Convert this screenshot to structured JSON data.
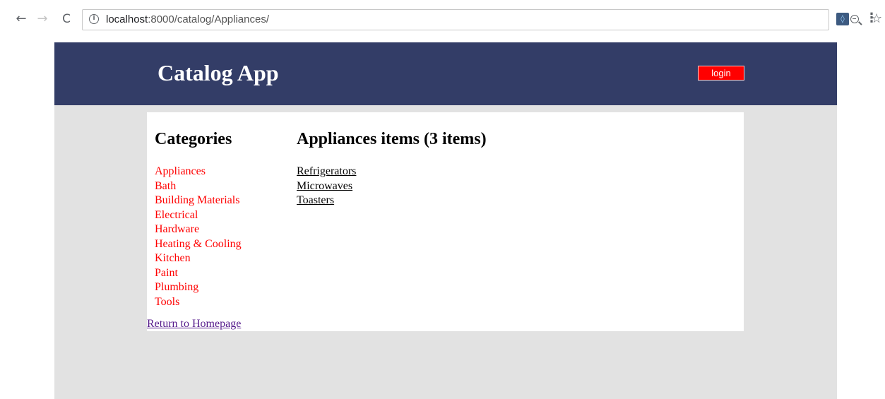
{
  "browser": {
    "url_host": "localhost",
    "url_rest": ":8000/catalog/Appliances/"
  },
  "header": {
    "title": "Catalog App",
    "login_label": "login"
  },
  "sidebar": {
    "heading": "Categories",
    "categories": [
      "Appliances",
      "Bath",
      "Building Materials",
      "Electrical",
      "Hardware",
      "Heating & Cooling",
      "Kitchen",
      "Paint",
      "Plumbing",
      "Tools"
    ],
    "return_link": "Return to Homepage"
  },
  "main": {
    "heading": "Appliances items (3 items)",
    "items": [
      "Refrigerators",
      "Microwaves",
      "Toasters"
    ]
  },
  "colors": {
    "header_bg": "#333d67",
    "page_bg": "#e2e2e2",
    "category_link": "#ff0000",
    "login_button": "#ff0000",
    "visited_link": "#551a8b"
  }
}
